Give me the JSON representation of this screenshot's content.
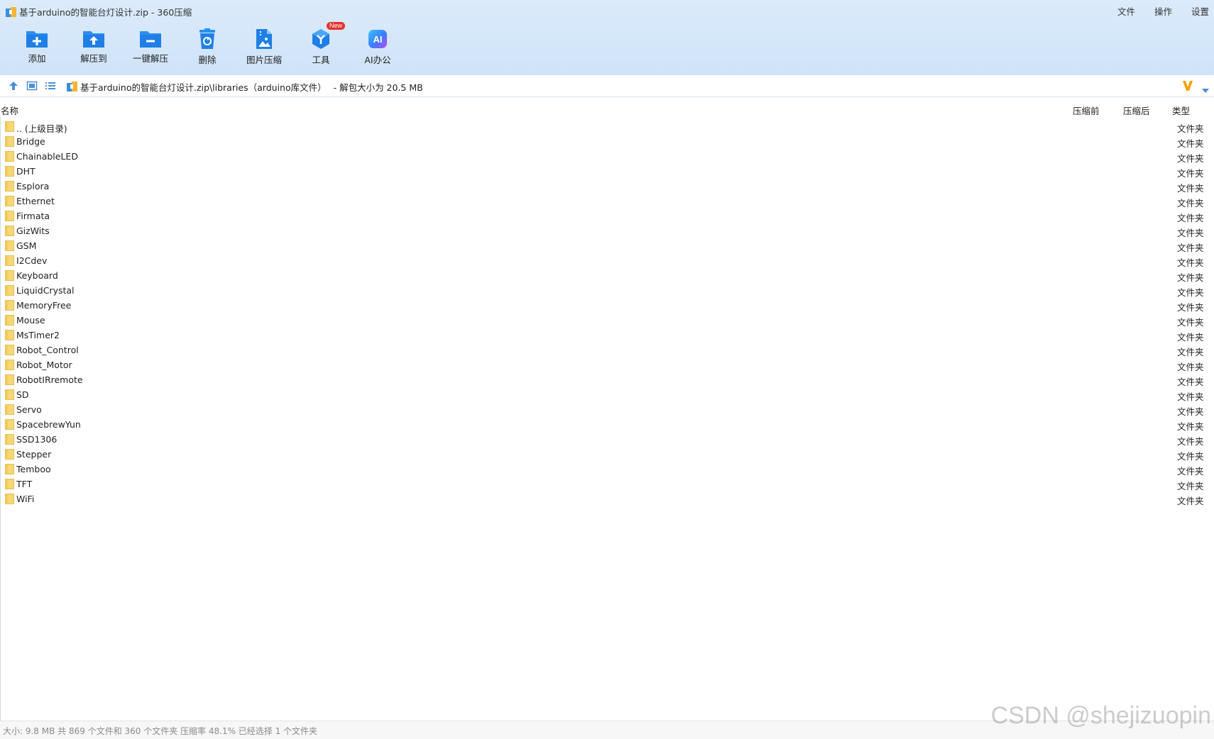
{
  "window": {
    "title": "基于arduino的智能台灯设计.zip - 360压缩",
    "menu": [
      "文件",
      "操作",
      "设置"
    ]
  },
  "toolbar": {
    "tools": [
      {
        "label": "添加",
        "icon": "add-icon"
      },
      {
        "label": "解压到",
        "icon": "extract-to-icon"
      },
      {
        "label": "一键解压",
        "icon": "one-click-extract-icon"
      },
      {
        "label": "删除",
        "icon": "delete-icon"
      },
      {
        "label": "图片压缩",
        "icon": "image-compress-icon"
      },
      {
        "label": "工具",
        "icon": "tools-icon",
        "badge": "New"
      },
      {
        "label": "AI办公",
        "icon": "ai-office-icon"
      }
    ]
  },
  "address": {
    "path": "基于arduino的智能台灯设计.zip\\libraries（arduino库文件）",
    "size_info": " - 解包大小为 20.5 MB"
  },
  "list": {
    "columns": {
      "name": "名称",
      "before": "压缩前",
      "after": "压缩后",
      "type": "类型"
    },
    "rows": [
      {
        "name": ".. (上级目录)",
        "type": "文件夹"
      },
      {
        "name": "Bridge",
        "type": "文件夹"
      },
      {
        "name": "ChainableLED",
        "type": "文件夹"
      },
      {
        "name": "DHT",
        "type": "文件夹"
      },
      {
        "name": "Esplora",
        "type": "文件夹"
      },
      {
        "name": "Ethernet",
        "type": "文件夹"
      },
      {
        "name": "Firmata",
        "type": "文件夹"
      },
      {
        "name": "GizWits",
        "type": "文件夹"
      },
      {
        "name": "GSM",
        "type": "文件夹"
      },
      {
        "name": "I2Cdev",
        "type": "文件夹"
      },
      {
        "name": "Keyboard",
        "type": "文件夹"
      },
      {
        "name": "LiquidCrystal",
        "type": "文件夹"
      },
      {
        "name": "MemoryFree",
        "type": "文件夹"
      },
      {
        "name": "Mouse",
        "type": "文件夹"
      },
      {
        "name": "MsTimer2",
        "type": "文件夹"
      },
      {
        "name": "Robot_Control",
        "type": "文件夹"
      },
      {
        "name": "Robot_Motor",
        "type": "文件夹"
      },
      {
        "name": "RobotIRremote",
        "type": "文件夹"
      },
      {
        "name": "SD",
        "type": "文件夹"
      },
      {
        "name": "Servo",
        "type": "文件夹"
      },
      {
        "name": "SpacebrewYun",
        "type": "文件夹"
      },
      {
        "name": "SSD1306",
        "type": "文件夹"
      },
      {
        "name": "Stepper",
        "type": "文件夹"
      },
      {
        "name": "Temboo",
        "type": "文件夹"
      },
      {
        "name": "TFT",
        "type": "文件夹"
      },
      {
        "name": "WiFi",
        "type": "文件夹"
      }
    ]
  },
  "status": {
    "text": "大小: 9.8 MB 共 869 个文件和 360 个文件夹 压缩率 48.1% 已经选择 1 个文件夹"
  },
  "watermark": "CSDN @shejizuopin",
  "colors": {
    "toolbar_bg": "#d6e8fa",
    "icon_blue": "#2b8ef0",
    "folder_yellow": "#f7d774",
    "badge_red": "#e4312b",
    "accent_orange": "#f5a300"
  }
}
